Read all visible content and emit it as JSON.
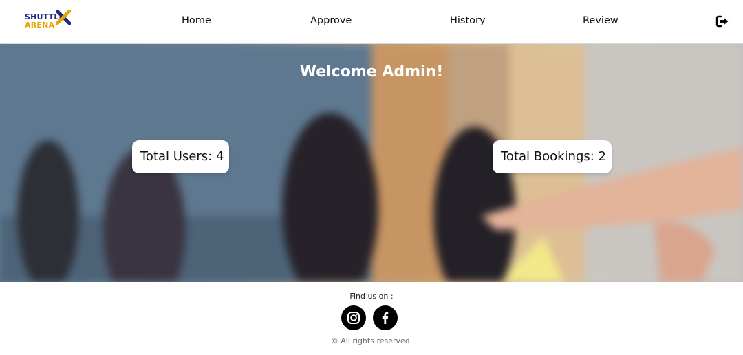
{
  "brand": {
    "line1": "SHUTTLE",
    "line2": "ARENA",
    "mark": "X",
    "colors": {
      "navy": "#1f2a7a",
      "gold": "#e8a400"
    }
  },
  "nav": {
    "items": [
      {
        "label": "Home"
      },
      {
        "label": "Approve"
      },
      {
        "label": "History"
      },
      {
        "label": "Review"
      }
    ],
    "logout_icon": "logout-icon"
  },
  "hero": {
    "title": "Welcome Admin!",
    "stats": [
      {
        "label": "Total Users: 4"
      },
      {
        "label": "Total Bookings: 2"
      }
    ]
  },
  "footer": {
    "find_us": "Find us on :",
    "social": [
      {
        "icon": "instagram-icon"
      },
      {
        "icon": "facebook-icon"
      }
    ],
    "copyright": "© All rights reserved."
  }
}
